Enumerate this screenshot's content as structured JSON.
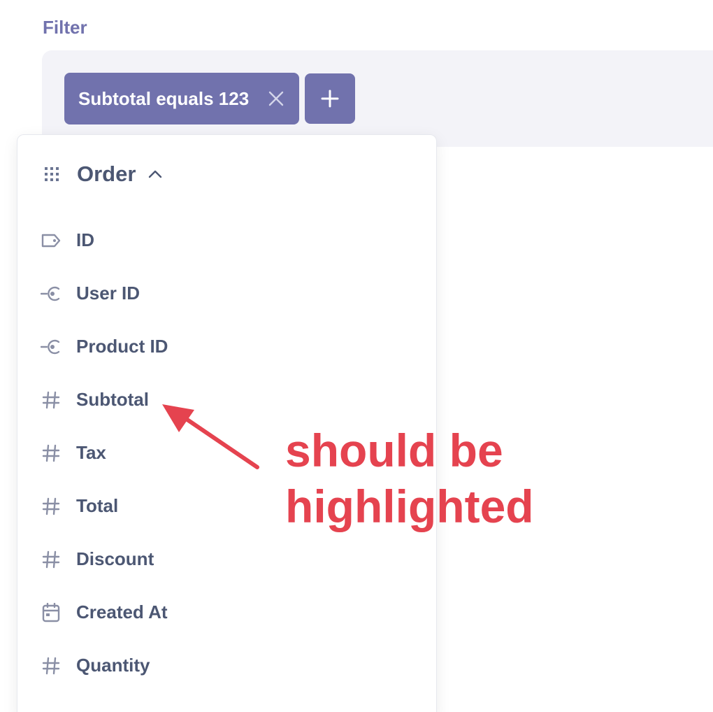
{
  "filter": {
    "label": "Filter",
    "active_filter": "Subtotal equals 123"
  },
  "popover": {
    "section_title": "Order",
    "fields": [
      {
        "label": "ID",
        "icon": "label-tag-icon"
      },
      {
        "label": "User ID",
        "icon": "foreign-key-icon"
      },
      {
        "label": "Product ID",
        "icon": "foreign-key-icon"
      },
      {
        "label": "Subtotal",
        "icon": "hash-icon"
      },
      {
        "label": "Tax",
        "icon": "hash-icon"
      },
      {
        "label": "Total",
        "icon": "hash-icon"
      },
      {
        "label": "Discount",
        "icon": "hash-icon"
      },
      {
        "label": "Created At",
        "icon": "calendar-icon"
      },
      {
        "label": "Quantity",
        "icon": "hash-icon"
      }
    ]
  },
  "annotation": {
    "line1": "should be",
    "line2": "highlighted"
  },
  "colors": {
    "brand": "#7172ad",
    "text": "#4c5773",
    "icon": "#8a8fa5",
    "annotation": "#e5434f",
    "bar_bg": "#f3f3f8"
  }
}
